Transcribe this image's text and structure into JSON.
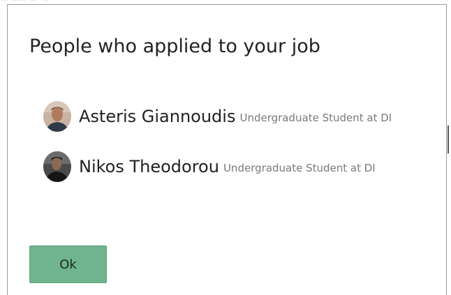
{
  "modal": {
    "title": "People who applied to your job",
    "applicants": [
      {
        "name": "Asteris Giannoudis",
        "role": "Undergraduate Student at DI",
        "avatar_icon": "user-photo-avatar"
      },
      {
        "name": "Nikos Theodorou",
        "role": "Undergraduate Student at DI",
        "avatar_icon": "user-photo-avatar"
      }
    ],
    "ok_label": "Ok"
  },
  "colors": {
    "ok_button": "#6fb38f",
    "title_text": "#222222",
    "role_text": "#7a7a7a",
    "modal_border": "#9a9a9a"
  }
}
